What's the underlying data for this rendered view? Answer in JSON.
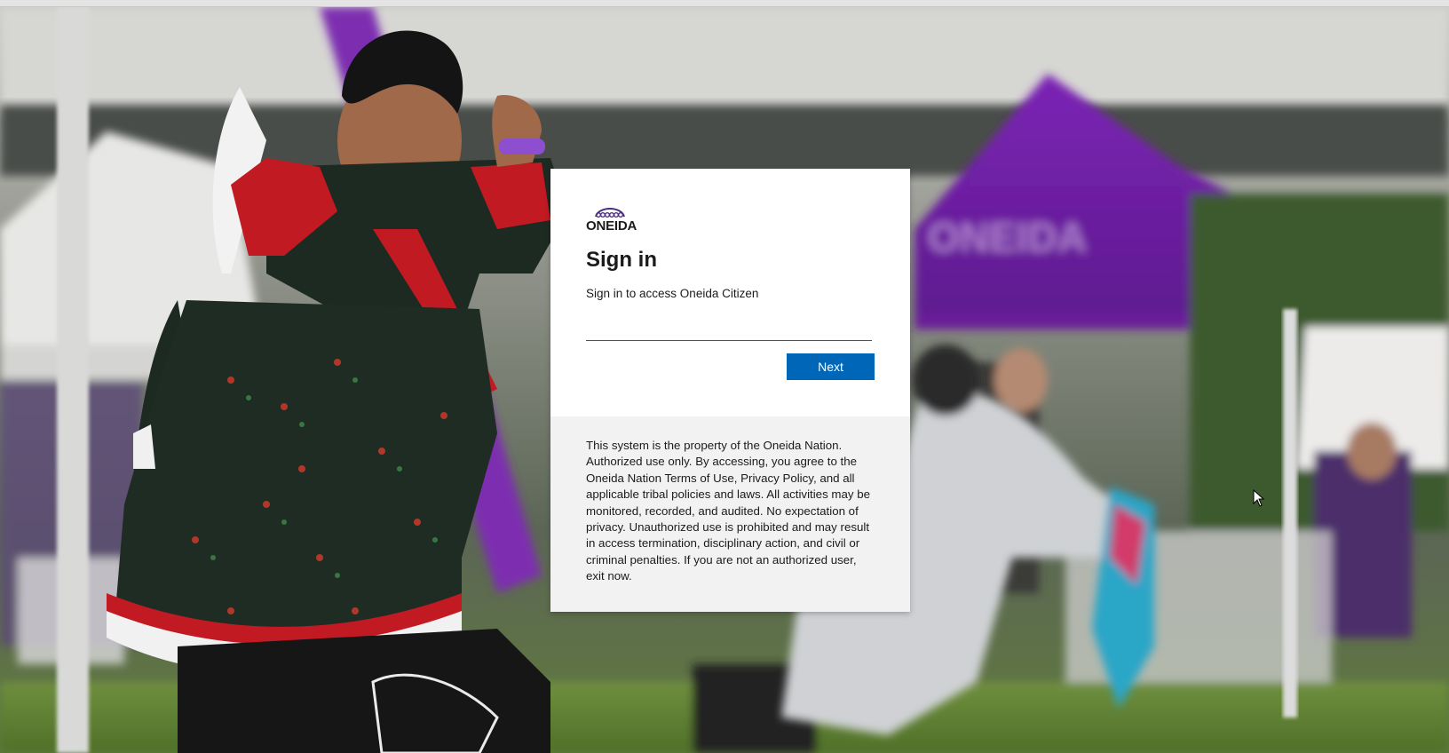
{
  "background": {
    "description_icon": "event-photo-background",
    "tent_banner_text": "ONEIDA"
  },
  "card": {
    "logo_text": "ONEIDA",
    "title": "Sign in",
    "subtitle": "Sign in to access Oneida Citizen",
    "input": {
      "value": "",
      "placeholder": ""
    },
    "next_label": "Next",
    "disclaimer": "This system is the property of the Oneida Nation. Authorized use only. By accessing, you agree to the Oneida Nation Terms of Use, Privacy Policy, and all applicable tribal policies and laws. All activities may be monitored, recorded, and audited. No expectation of privacy. Unauthorized use is prohibited and may result in access termination, disciplinary action, and civil or criminal penalties. If you are not an authorized user, exit now."
  },
  "colors": {
    "accent": "#0067b8",
    "card_top": "#ffffff",
    "card_bottom": "#f2f2f2",
    "tent_purple": "#8a2fc0"
  }
}
